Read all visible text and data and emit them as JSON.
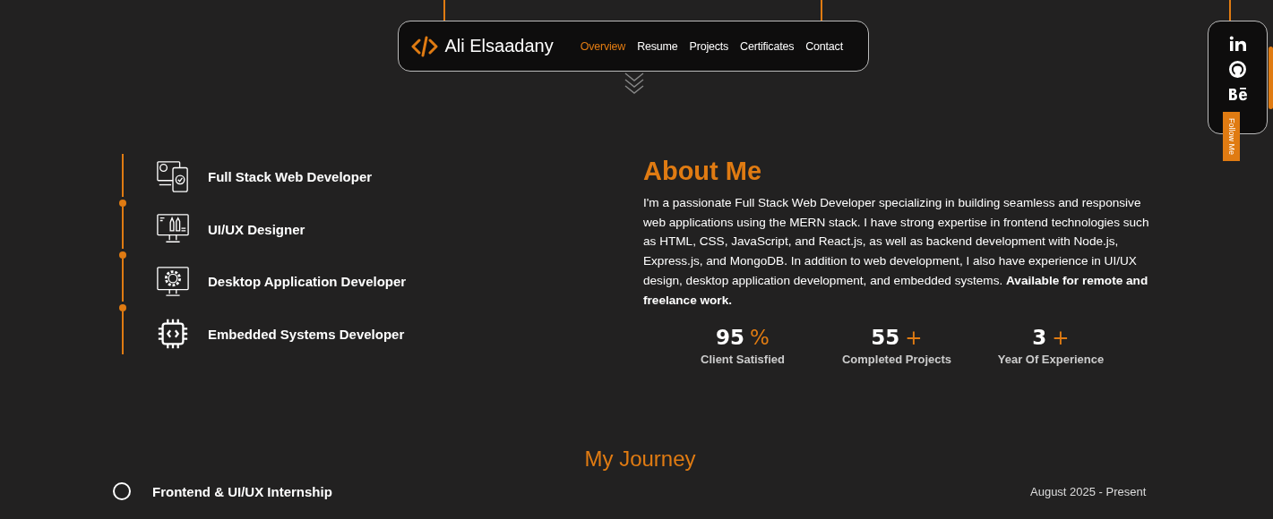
{
  "nav": {
    "brand": "Ali Elsaadany",
    "links": [
      {
        "label": "Overview",
        "selected": true
      },
      {
        "label": "Resume",
        "selected": false
      },
      {
        "label": "Projects",
        "selected": false
      },
      {
        "label": "Certificates",
        "selected": false
      },
      {
        "label": "Contact",
        "selected": false
      }
    ]
  },
  "social": {
    "links": [
      {
        "kind": "linkedin"
      },
      {
        "kind": "github"
      },
      {
        "kind": "behance"
      }
    ],
    "follow_label": "Follow Me"
  },
  "roles": [
    {
      "kind": "fullstack",
      "label": "Full Stack Web Developer"
    },
    {
      "kind": "design",
      "label": "UI/UX Designer"
    },
    {
      "kind": "desktop",
      "label": "Desktop Application Developer"
    },
    {
      "kind": "embedded",
      "label": "Embedded Systems Developer"
    }
  ],
  "about": {
    "title": "About Me",
    "text": "I'm a passionate Full Stack Web Developer specializing in building seamless and responsive web applications using the MERN stack. I have strong expertise in frontend technologies such as HTML, CSS, JavaScript, and React.js, as well as backend development with Node.js, Express.js, and MongoDB. In addition to web development, I also have experience in UI/UX design, desktop application development, and embedded systems.",
    "note": "Available for remote and freelance work.",
    "stats": [
      {
        "value": "95",
        "suffix": "%",
        "label": "Client Satisfied"
      },
      {
        "value": "55",
        "suffix": "+",
        "label": "Completed Projects"
      },
      {
        "value": "3",
        "suffix": "+",
        "label": "Year Of Experience"
      }
    ]
  },
  "journey": {
    "title": "My Journey",
    "entries": [
      {
        "title": "Frontend & UI/UX Internship",
        "date": "August 2025 - Present"
      }
    ]
  }
}
